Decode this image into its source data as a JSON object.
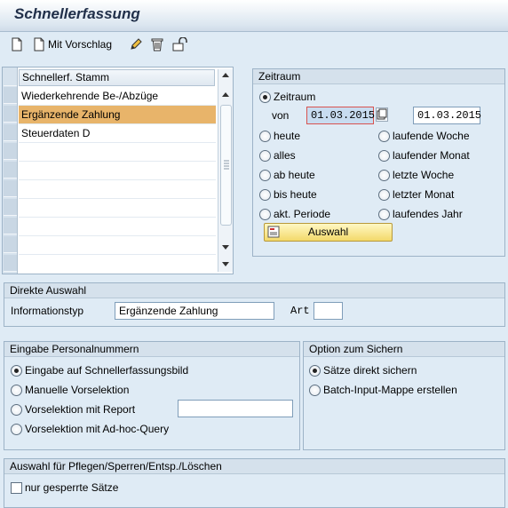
{
  "title": "Schnellerfassung",
  "toolbar": {
    "new_icon": "new-document-icon",
    "with_template_label": "Mit Vorschlag",
    "edit_icon": "pencil-icon",
    "delete_icon": "trash-icon",
    "lock_icon": "lock-icon"
  },
  "table": {
    "column_header": "Schnellerf. Stamm",
    "rows": [
      "Wiederkehrende Be-/Abzüge",
      "Ergänzende Zahlung",
      "Steuerdaten D"
    ],
    "selected_row": "Ergänzende Zahlung"
  },
  "zeitraum": {
    "group_title": "Zeitraum",
    "radio_zeitraum": "Zeitraum",
    "von_label": "von",
    "von_value": "01.03.2015",
    "bis_value": "01.03.2015",
    "options_left": [
      "heute",
      "alles",
      "ab heute",
      "bis heute",
      "akt. Periode"
    ],
    "options_right": [
      "laufende Woche",
      "laufender Monat",
      "letzte Woche",
      "letzter Monat",
      "laufendes Jahr"
    ],
    "auswahl_button": "Auswahl"
  },
  "direkte_auswahl": {
    "group_title": "Direkte Auswahl",
    "infotyp_label": "Informationstyp",
    "infotyp_value": "Ergänzende Zahlung",
    "art_label": "Art",
    "art_value": ""
  },
  "eingabe": {
    "group_title": "Eingabe Personalnummern",
    "options": [
      "Eingabe auf Schnellerfassungsbild",
      "Manuelle Vorselektion",
      "Vorselektion mit Report",
      "Vorselektion mit Ad-hoc-Query"
    ],
    "report_value": ""
  },
  "sichern": {
    "group_title": "Option zum Sichern",
    "options": [
      "Sätze direkt sichern",
      "Batch-Input-Mappe erstellen"
    ]
  },
  "pflegen": {
    "group_title": "Auswahl für Pflegen/Sperren/Entsp./Löschen",
    "checkbox_label": "nur gesperrte Sätze"
  },
  "colors": {
    "background": "#dfebf5",
    "selected_row": "#e8b46a",
    "title_text": "#21304a"
  }
}
